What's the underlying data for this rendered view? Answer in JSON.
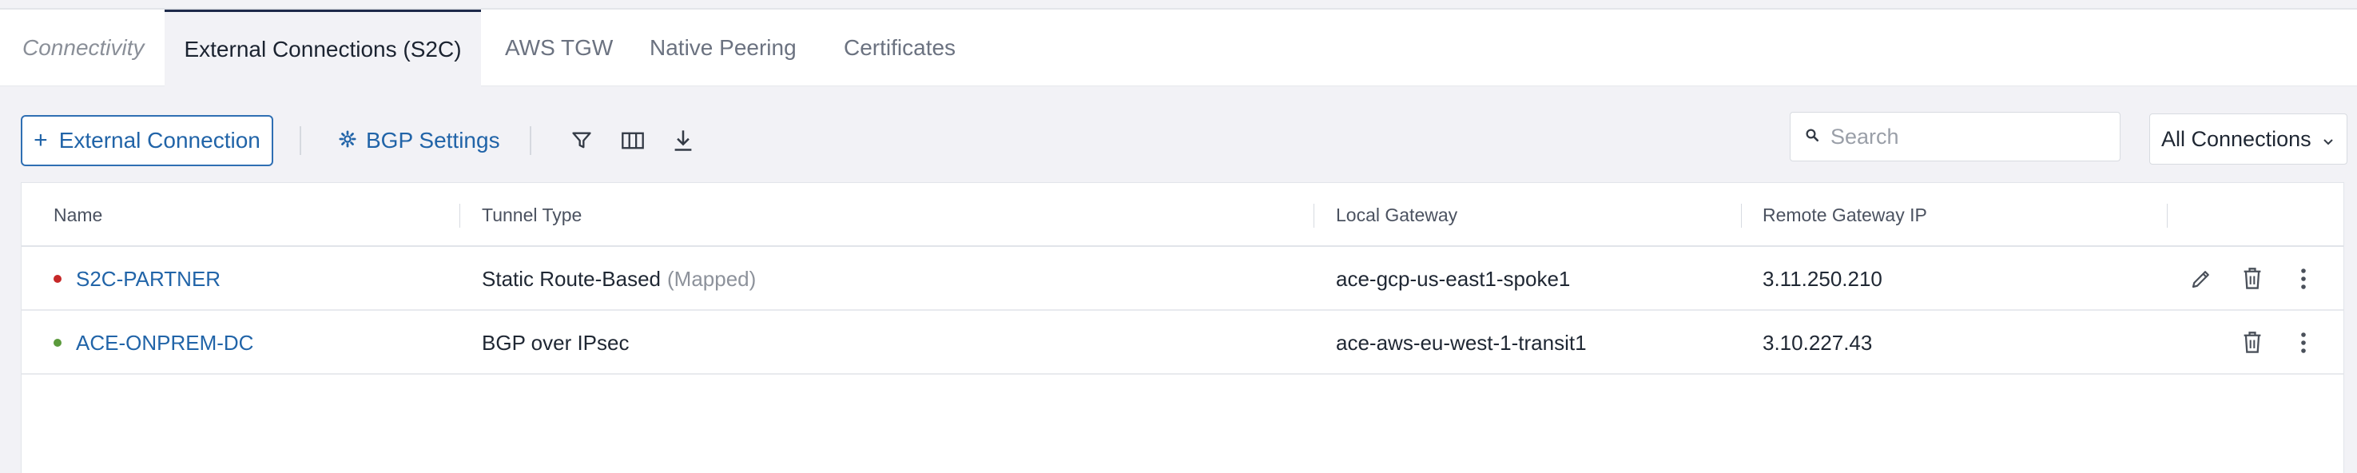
{
  "tabs": [
    {
      "label": "Connectivity"
    },
    {
      "label": "External Connections (S2C)"
    },
    {
      "label": "AWS TGW"
    },
    {
      "label": "Native Peering"
    },
    {
      "label": "Certificates"
    }
  ],
  "toolbar": {
    "add_label": "External Connection",
    "bgp_label": "BGP Settings",
    "filter_icon": "filter-icon",
    "columns_icon": "columns-icon",
    "download_icon": "download-icon"
  },
  "search": {
    "placeholder": "Search",
    "value": ""
  },
  "filter_select": {
    "value": "All Connections"
  },
  "table": {
    "headers": {
      "name": "Name",
      "tunnel_type": "Tunnel Type",
      "local_gateway": "Local Gateway",
      "remote_ip": "Remote Gateway IP"
    },
    "rows": [
      {
        "status": "down",
        "name": "S2C-PARTNER",
        "tunnel_type": "Static Route-Based",
        "tunnel_note": "(Mapped)",
        "local_gateway": "ace-gcp-us-east1-spoke1",
        "remote_ip": "3.11.250.210",
        "actions": [
          "edit-icon",
          "delete-icon",
          "more-icon"
        ]
      },
      {
        "status": "up",
        "name": "ACE-ONPREM-DC",
        "tunnel_type": "BGP over IPsec",
        "tunnel_note": "",
        "local_gateway": "ace-aws-eu-west-1-transit1",
        "remote_ip": "3.10.227.43",
        "actions": [
          "delete-icon",
          "more-icon"
        ]
      }
    ]
  },
  "colors": {
    "accent": "#2164a8",
    "status_down": "#c62828",
    "status_up": "#5b9a3c"
  }
}
